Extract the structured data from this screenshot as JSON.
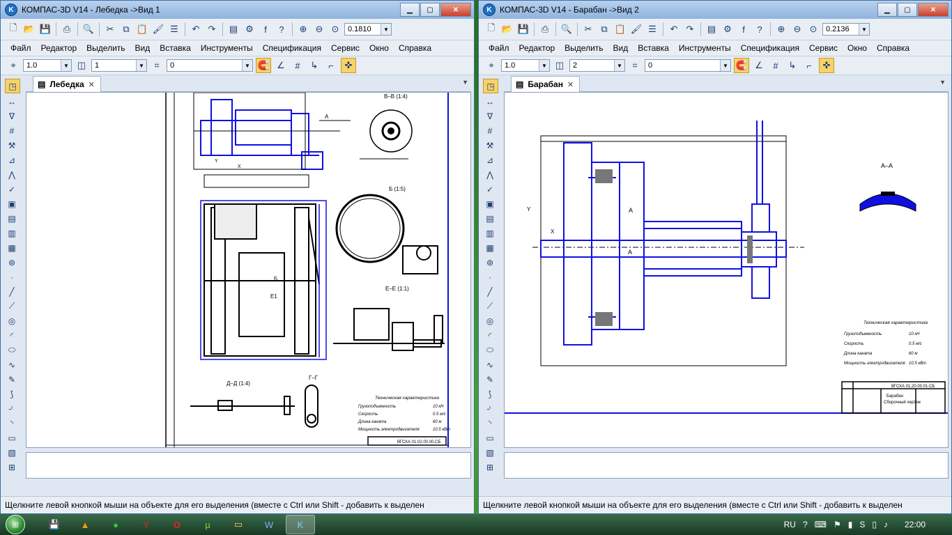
{
  "windows": [
    {
      "title": "КОМПАС-3D V14 - Лебедка ->Вид 1",
      "zoom": "0.1810",
      "menu": [
        "Файл",
        "Редактор",
        "Выделить",
        "Вид",
        "Вставка",
        "Инструменты",
        "Спецификация",
        "Сервис",
        "Окно",
        "Справка"
      ],
      "props": {
        "scale": "1.0",
        "layer": "1",
        "style": "0"
      },
      "tab": "Лебедка",
      "status": "Щелкните левой кнопкой мыши на объекте для его выделения (вместе с Ctrl или Shift - добавить к выделен",
      "drawing": {
        "section_bb": "В–В (1:4)",
        "section_b": "Б (1:5)",
        "section_ee": "Е–Е (1:1)",
        "section_dd": "Д–Д (1:4)",
        "section_gg": "Г–Г",
        "tech_title": "Техническая характеристика",
        "tech_rows": [
          {
            "label": "Грузоподъемность",
            "value": "10 кН"
          },
          {
            "label": "Скорость",
            "value": "0.5 м/с"
          },
          {
            "label": "Длина каната",
            "value": "60 м"
          },
          {
            "label": "Мощность электродвигателя",
            "value": "10.5 кВт"
          }
        ],
        "stamp": "ВГСХА 01.02.00.00.СБ"
      }
    },
    {
      "title": "КОМПАС-3D V14 - Барабан ->Вид 2",
      "zoom": "0.2136",
      "menu": [
        "Файл",
        "Редактор",
        "Выделить",
        "Вид",
        "Вставка",
        "Инструменты",
        "Спецификация",
        "Сервис",
        "Окно",
        "Справка"
      ],
      "props": {
        "scale": "1.0",
        "layer": "2",
        "style": "0"
      },
      "tab": "Барабан",
      "status": "Щелкните левой кнопкой мыши на объекте для его выделения (вместе с Ctrl или Shift - добавить к выделен",
      "drawing": {
        "section_aa": "А–А",
        "tech_title": "Техническая характеристика",
        "tech_rows": [
          {
            "label": "Грузоподъемность",
            "value": "10 кН"
          },
          {
            "label": "Скорость",
            "value": "0.5 м/с"
          },
          {
            "label": "Длина каната",
            "value": "60 м"
          },
          {
            "label": "Мощность электродвигателя",
            "value": "10.5 кВт"
          }
        ],
        "stamp": "ВГСХА 01.20.00.01.СБ",
        "stamp_name": "Барабан",
        "stamp_sub": "Сборочный чертеж"
      }
    }
  ],
  "taskbar": {
    "lang": "RU",
    "time": "22:00"
  },
  "colors": {
    "drawing_line": "#1010e0",
    "dark_line": "#000000"
  }
}
